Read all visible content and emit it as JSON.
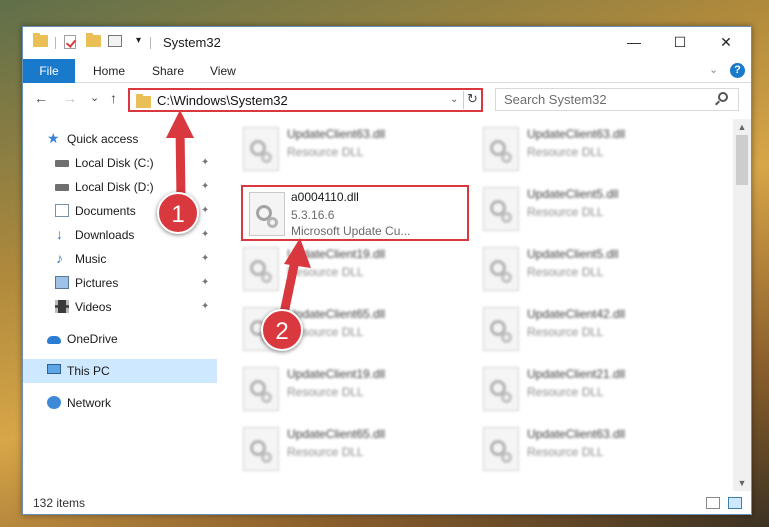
{
  "window": {
    "title": "System32",
    "controls": {
      "minimize": "—",
      "maximize": "☐",
      "close": "✕"
    }
  },
  "ribbon": {
    "file_tab": "File",
    "tabs": [
      "Home",
      "Share",
      "View"
    ],
    "expand_glyph": "⌄",
    "help_glyph": "?"
  },
  "navigation": {
    "back_glyph": "←",
    "forward_glyph": "→",
    "recent_glyph": "⌄",
    "up_glyph": "↑",
    "address_path": "C:\\Windows\\System32",
    "address_drop_glyph": "⌄",
    "refresh_glyph": "↻",
    "search_placeholder": "Search System32"
  },
  "sidebar": {
    "quick_access": "Quick access",
    "items": [
      {
        "label": "Local Disk (C:)",
        "icon": "drive-icon",
        "pinned": true
      },
      {
        "label": "Local Disk (D:)",
        "icon": "drive-icon",
        "pinned": true
      },
      {
        "label": "Documents",
        "icon": "documents-icon",
        "pinned": true
      },
      {
        "label": "Downloads",
        "icon": "downloads-icon",
        "pinned": true
      },
      {
        "label": "Music",
        "icon": "music-icon",
        "pinned": true
      },
      {
        "label": "Pictures",
        "icon": "pictures-icon",
        "pinned": true
      },
      {
        "label": "Videos",
        "icon": "videos-icon",
        "pinned": true
      }
    ],
    "onedrive": "OneDrive",
    "this_pc": "This PC",
    "network": "Network",
    "pin_glyph": "📌"
  },
  "files": {
    "left_column": [
      {
        "name": "UpdateClient63.dll",
        "desc": "Resource DLL"
      },
      {
        "name": "UpdateClient19.dll",
        "desc": "Resource DLL"
      },
      {
        "name": "UpdateClient65.dll",
        "desc": "Resource DLL"
      },
      {
        "name": "UpdateClient19.dll",
        "desc": "Resource DLL"
      },
      {
        "name": "UpdateClient65.dll",
        "desc": "Resource DLL"
      }
    ],
    "right_column": [
      {
        "name": "UpdateClient63.dll",
        "desc": "Resource DLL"
      },
      {
        "name": "UpdateClient5.dll",
        "desc": "Resource DLL"
      },
      {
        "name": "UpdateClient5.dll",
        "desc": "Resource DLL"
      },
      {
        "name": "UpdateClient42.dll",
        "desc": "Resource DLL"
      },
      {
        "name": "UpdateClient21.dll",
        "desc": "Resource DLL"
      },
      {
        "name": "UpdateClient63.dll",
        "desc": "Resource DLL"
      }
    ],
    "highlighted": {
      "name": "a0004110.dll",
      "version": "5.3.16.6",
      "description": "Microsoft Update Cu..."
    }
  },
  "status": {
    "item_count": "132 items"
  },
  "annotations": {
    "step1": "1",
    "step2": "2",
    "color": "#d9383e"
  }
}
